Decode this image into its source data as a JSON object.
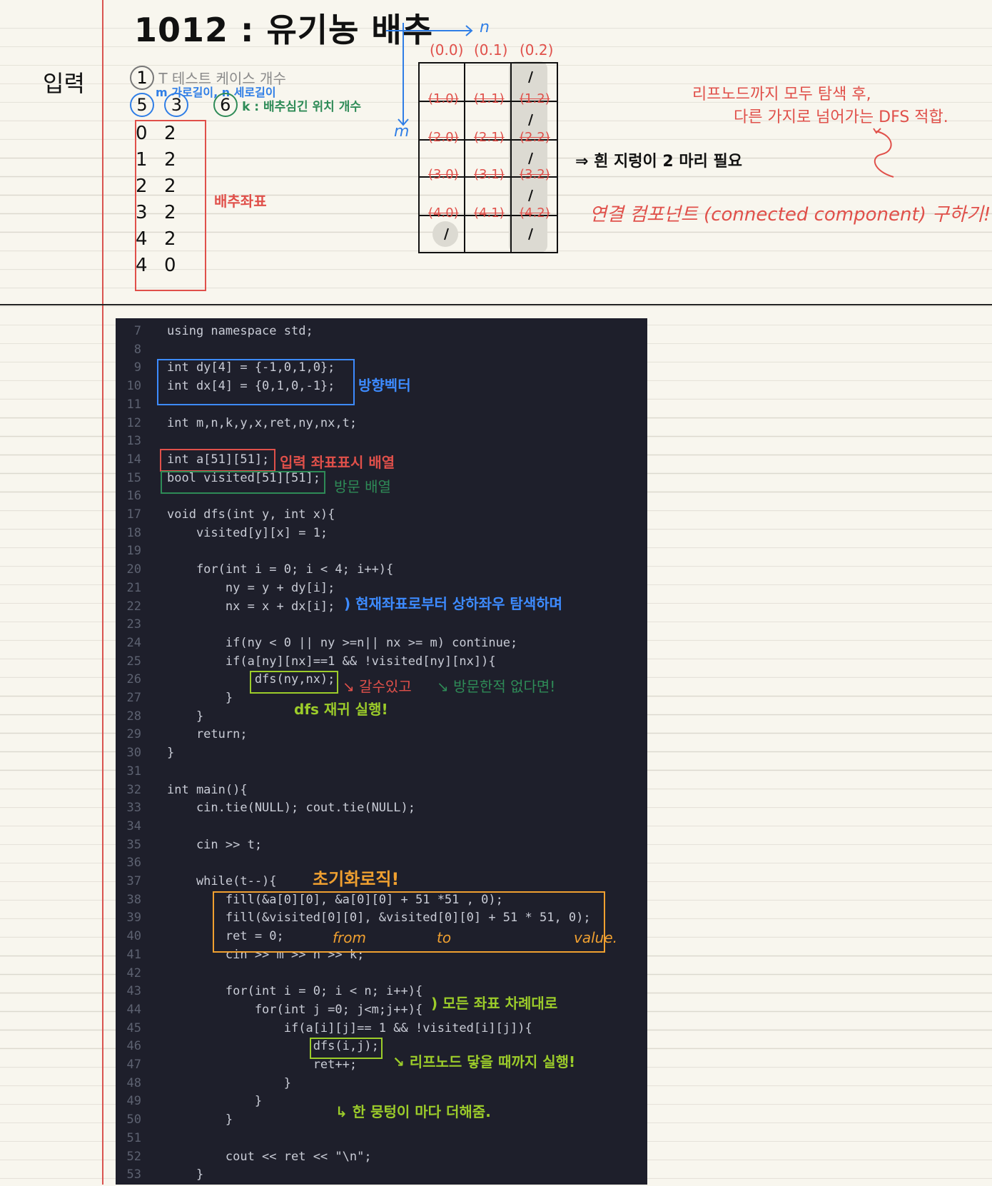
{
  "header": {
    "title": "1012 : 유기농 배추",
    "input_label": "입력"
  },
  "input_notes": {
    "t_num": "1",
    "t_text": "T 테스트 케이스 개수",
    "m_text": "m 가로길이, n 세로길이",
    "m_val": "5",
    "n_val": "3",
    "k_val": "6",
    "k_text": "k : 배추심긴 위치 개수",
    "cabbage_label": "배추좌표",
    "coords": [
      [
        "0",
        "2"
      ],
      [
        "1",
        "2"
      ],
      [
        "2",
        "2"
      ],
      [
        "3",
        "2"
      ],
      [
        "4",
        "2"
      ],
      [
        "4",
        "0"
      ]
    ]
  },
  "grid": {
    "axis_n": "n",
    "axis_m": "m",
    "col_headers": [
      "(0.0)",
      "(0.1)",
      "(0.2)"
    ],
    "cells": [
      "(1.0)",
      "(1.1)",
      "(1.2)",
      "(2.0)",
      "(2.1)",
      "(2.2)",
      "(3.0)",
      "(3.1)",
      "(3.2)",
      "(4.0)",
      "(4.1)",
      "(4.2)"
    ],
    "arrow_note": "⇒ 흰 지렁이 2 마리 필요"
  },
  "right_notes": {
    "line1": "리프노드까지 모두 탐색 후,",
    "line2": "다른 가지로 넘어가는 DFS 적합.",
    "line3": "연결 컴포넌트 (connected component) 구하기!"
  },
  "code": {
    "lines": [
      {
        "n": "7",
        "t": "using namespace std;"
      },
      {
        "n": "8",
        "t": ""
      },
      {
        "n": "9",
        "t": "int dy[4] = {-1,0,1,0};"
      },
      {
        "n": "10",
        "t": "int dx[4] = {0,1,0,-1};"
      },
      {
        "n": "11",
        "t": ""
      },
      {
        "n": "12",
        "t": "int m,n,k,y,x,ret,ny,nx,t;"
      },
      {
        "n": "13",
        "t": ""
      },
      {
        "n": "14",
        "t": "int a[51][51];"
      },
      {
        "n": "15",
        "t": "bool visited[51][51];"
      },
      {
        "n": "16",
        "t": ""
      },
      {
        "n": "17",
        "t": "void dfs(int y, int x){"
      },
      {
        "n": "18",
        "t": "    visited[y][x] = 1;"
      },
      {
        "n": "19",
        "t": ""
      },
      {
        "n": "20",
        "t": "    for(int i = 0; i < 4; i++){"
      },
      {
        "n": "21",
        "t": "        ny = y + dy[i];"
      },
      {
        "n": "22",
        "t": "        nx = x + dx[i];"
      },
      {
        "n": "23",
        "t": ""
      },
      {
        "n": "24",
        "t": "        if(ny < 0 || ny >=n|| nx >= m) continue;"
      },
      {
        "n": "25",
        "t": "        if(a[ny][nx]==1 && !visited[ny][nx]){"
      },
      {
        "n": "26",
        "t": "            dfs(ny,nx);"
      },
      {
        "n": "27",
        "t": "        }"
      },
      {
        "n": "28",
        "t": "    }"
      },
      {
        "n": "29",
        "t": "    return;"
      },
      {
        "n": "30",
        "t": "}"
      },
      {
        "n": "31",
        "t": ""
      },
      {
        "n": "32",
        "t": "int main(){"
      },
      {
        "n": "33",
        "t": "    cin.tie(NULL); cout.tie(NULL);"
      },
      {
        "n": "34",
        "t": ""
      },
      {
        "n": "35",
        "t": "    cin >> t;"
      },
      {
        "n": "36",
        "t": ""
      },
      {
        "n": "37",
        "t": "    while(t--){"
      },
      {
        "n": "38",
        "t": "        fill(&a[0][0], &a[0][0] + 51 *51 , 0);"
      },
      {
        "n": "39",
        "t": "        fill(&visited[0][0], &visited[0][0] + 51 * 51, 0);"
      },
      {
        "n": "40",
        "t": "        ret = 0;"
      },
      {
        "n": "41",
        "t": "        cin >> m >> n >> k;"
      },
      {
        "n": "42",
        "t": ""
      },
      {
        "n": "43",
        "t": "        for(int i = 0; i < n; i++){"
      },
      {
        "n": "44",
        "t": "            for(int j =0; j<m;j++){"
      },
      {
        "n": "45",
        "t": "                if(a[i][j]== 1 && !visited[i][j]){"
      },
      {
        "n": "46",
        "t": "                    dfs(i,j);"
      },
      {
        "n": "47",
        "t": "                    ret++;"
      },
      {
        "n": "48",
        "t": "                }"
      },
      {
        "n": "49",
        "t": "            }"
      },
      {
        "n": "50",
        "t": "        }"
      },
      {
        "n": "51",
        "t": ""
      },
      {
        "n": "52",
        "t": "        cout << ret << \"\\n\";"
      },
      {
        "n": "53",
        "t": "    }"
      }
    ]
  },
  "annotations": {
    "dir_vector": "방향벡터",
    "input_array": "입력 좌표표시 배열",
    "visit_array": "방문 배열",
    "scan_dirs": "현재좌표로부터 상하좌우 탐색하며",
    "can_go": "갈수있고",
    "not_visited": "↘ 방문한적 없다면!",
    "dfs_recursive": "dfs 재귀 실행!",
    "init_logic": "초기화로직!",
    "from": "from",
    "to": "to",
    "value": "value.",
    "all_coords": "모든 좌표 차례대로",
    "until_leaf": "↘ 리프노드 닿을 때까지 실행!",
    "one_group": "↳ 한 뭉텅이 마다 더해줌."
  },
  "colors": {
    "margin": "#d9534f",
    "code_bg": "#1e1f2b",
    "blue_note": "#2f7ee6",
    "red_note": "#e0504a",
    "green_note": "#2e8b57"
  }
}
